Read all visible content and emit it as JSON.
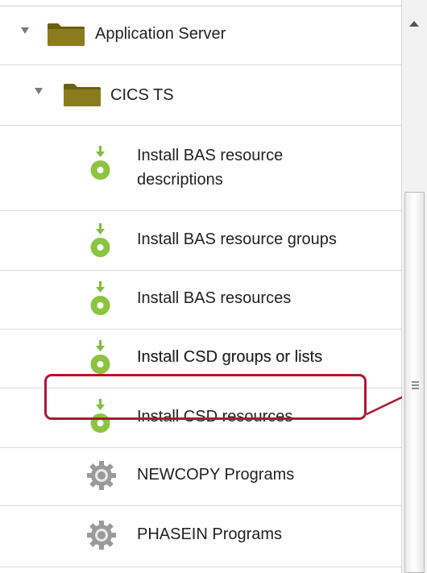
{
  "tree": {
    "items": [
      {
        "label": "Application Server",
        "type": "folder",
        "expanded": true,
        "icon": "folder-icon"
      },
      {
        "label": "CICS TS",
        "type": "folder",
        "expanded": true,
        "icon": "folder-icon"
      },
      {
        "label_line1": "Install BAS resource",
        "label_line2": "descriptions",
        "type": "action",
        "icon": "install-icon"
      },
      {
        "label": "Install BAS resource groups",
        "type": "action",
        "icon": "install-icon"
      },
      {
        "label": "Install BAS resources",
        "type": "action",
        "icon": "install-icon"
      },
      {
        "label": "Install CSD groups or lists",
        "type": "action",
        "icon": "install-icon"
      },
      {
        "label": "Install CSD resources",
        "type": "action",
        "icon": "install-icon"
      },
      {
        "label": "NEWCOPY Programs",
        "type": "action",
        "icon": "gear-icon",
        "highlighted": true
      },
      {
        "label": "PHASEIN Programs",
        "type": "action",
        "icon": "gear-icon"
      }
    ]
  },
  "colors": {
    "folder": "#8b7b1f",
    "install_icon": "#8bc43f",
    "gear_icon": "#9a9a9a",
    "highlight": "#b0172d"
  }
}
